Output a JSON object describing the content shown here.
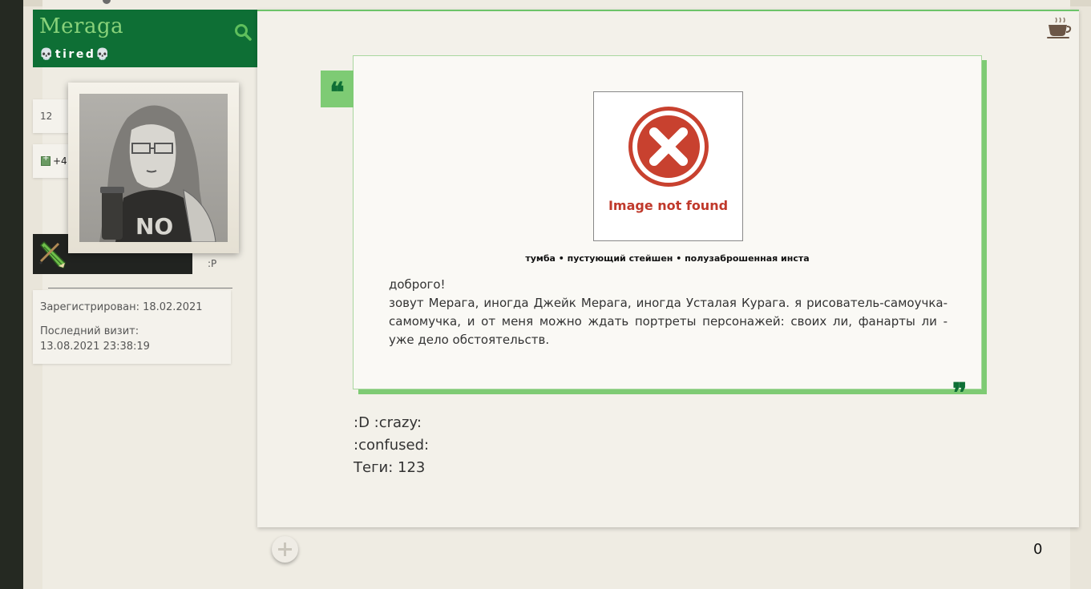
{
  "profile": {
    "username": "Meraga",
    "status": "💀tired💀",
    "posts_count": "12",
    "reputation": "+4",
    "custom_field": ":P",
    "registered": "Зарегистрирован: 18.02.2021",
    "last_visit_label": "Последний визит:",
    "last_visit_date": "13.08.2021 23:38:19"
  },
  "post": {
    "image_alt_text": "Image not found",
    "caption": "тумба • пустующий стейшен • полузаброшенная инста",
    "greeting": "доброго!",
    "body": "зовут Мерага, иногда Джейк Мерага, иногда Усталая Курага. я рисователь-самоучка-самомучка, и от меня можно ждать портреты персонажей: своих ли, фанарты ли - уже дело обстоятельств.",
    "after_lines": [
      ":D  :crazy:",
      ":confused:",
      "Теги: 123"
    ],
    "rating": "0"
  },
  "icons": [
    "search-icon",
    "cup-icon",
    "error-icon",
    "pencil-icon",
    "plus-icon"
  ],
  "colors": {
    "header_green": "#0e6f35",
    "accent_green": "#7ecb74",
    "username_green": "#89d27a",
    "error_red": "#c0392b"
  }
}
